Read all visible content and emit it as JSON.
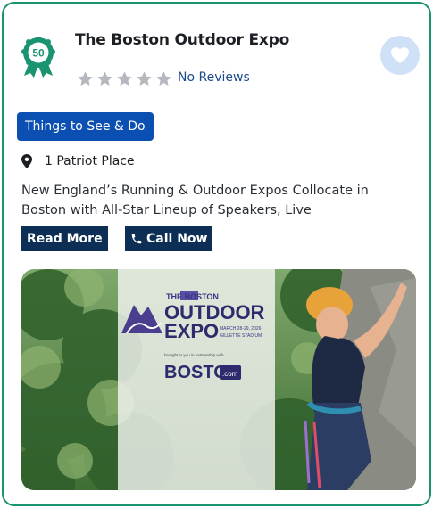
{
  "listing": {
    "badge_number": "50",
    "title": "The Boston Outdoor Expo",
    "rating_stars": 0,
    "reviews_label": "No Reviews",
    "category_label": "Things to See & Do",
    "address": "1 Patriot Place",
    "description": "New England’s Running & Outdoor Expos Collocate in Boston with All-Star Lineup of Speakers, Live",
    "read_more_label": "Read More",
    "call_now_label": "Call Now"
  },
  "image": {
    "logo_top": "THE BOSTON",
    "logo_main_1": "OUTDOOR",
    "logo_main_2": "EXPO",
    "logo_date": "MARCH 28-29, 2026",
    "logo_venue": "GILLETTE STADIUM",
    "partner_line": "brought to you in partnership with",
    "partner_name": "BOSTON",
    "partner_suffix": ".com"
  },
  "colors": {
    "card_border": "#1a9470",
    "badge_green": "#1a9470",
    "category_bg": "#0b4fb3",
    "button_bg": "#0d2f55",
    "favorite_bg": "#cfe1f7",
    "star_empty": "#b5b9bf"
  }
}
